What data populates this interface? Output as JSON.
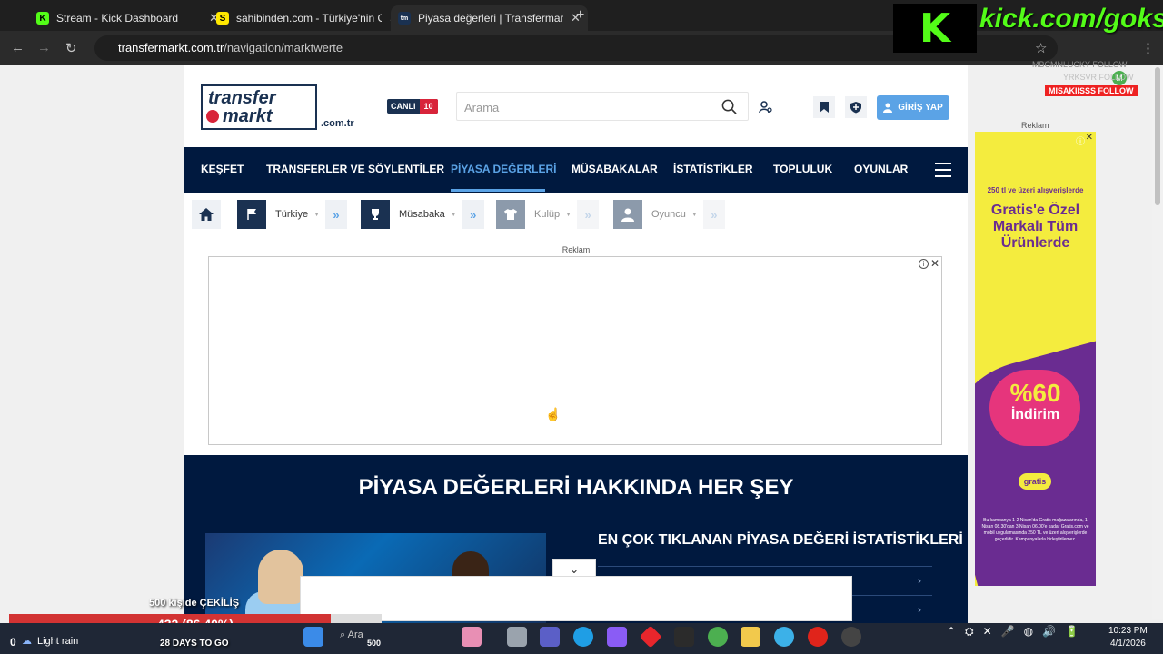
{
  "browser": {
    "tabs": [
      {
        "label": "Stream - Kick Dashboard",
        "favicon": "kick-icon",
        "color": "#53fc18",
        "letter": "K"
      },
      {
        "label": "sahibinden.com - Türkiye'nin O",
        "favicon": "sahibinden-icon",
        "color": "#ffe800",
        "letter": "S"
      },
      {
        "label": "Piyasa değerleri | Transfermarkt",
        "favicon": "transfermarkt-icon",
        "color": "#1a3151",
        "letter": "tm"
      }
    ],
    "url_host": "transfermarkt.com.tr",
    "url_path": "/navigation/marktwerte"
  },
  "overlay": {
    "kick_text": "kick.com/goksxll",
    "follow1": "MBCMNLUCKY FOLLOW",
    "follow2": "YRKSVR FOLLOW",
    "follow3": "MISAKIISSS FOLLOW",
    "giveaway": "500 kişide ÇEKİLİŞ",
    "progress_text": "432 (86.40%)",
    "progress_value": 0.864,
    "countdown": "28 DAYS TO GO"
  },
  "site": {
    "logo_line1": "transfer",
    "logo_line2": "markt",
    "logo_suffix": ".com.tr",
    "live_label": "CANLI",
    "live_count": "10",
    "search_placeholder": "Arama",
    "login_label": "GİRİŞ YAP",
    "nav": [
      {
        "label": "KEŞFET",
        "active": false
      },
      {
        "label": "TRANSFERLER VE SÖYLENTİLER",
        "active": false
      },
      {
        "label": "PİYASA DEĞERLERİ",
        "active": true
      },
      {
        "label": "MÜSABAKALAR",
        "active": false
      },
      {
        "label": "İSTATİSTİKLER",
        "active": false
      },
      {
        "label": "TOPLULUK",
        "active": false
      },
      {
        "label": "OYUNLAR",
        "active": false
      }
    ],
    "breadcrumbs": [
      "Türkiye",
      "Müsabaka",
      "Kulüp",
      "Oyuncu"
    ],
    "ad_label": "Reklam",
    "section_title": "PİYASA DEĞERLERİ HAKKINDA HER ŞEY",
    "stats_title": "EN ÇOK TIKLANAN PİYASA DEĞERİ İSTATİSTİKLERİ"
  },
  "side_ad": {
    "label": "Reklam",
    "line1": "250 tl ve üzeri alışverişlerde",
    "line2": "Gratis'e Özel Markalı Tüm Ürünlerde",
    "line3": "%60",
    "line4": "İndirim",
    "brand": "gratis",
    "fine": "Bu kampanya 1-2 Nisan'da Gratis mağazalarında, 1 Nisan 08.30'dan 3 Nisan 06.00'e kadar Gratis.com ve mobil uygulamasında 250 TL ve üzeri alışverişlerde geçerlidir. Kampanyalarla birleştirilemez."
  },
  "taskbar": {
    "zero": "0",
    "weather": "Light rain",
    "search": "Ara",
    "time": "10:23 PM",
    "date": "4/1/2026"
  }
}
